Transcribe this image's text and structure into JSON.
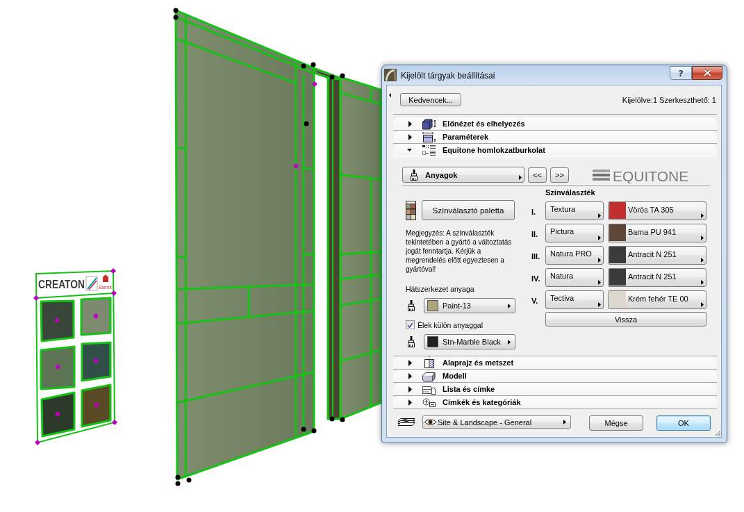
{
  "scene": {
    "board": {
      "logo": "CREATON",
      "brand": "Eternit",
      "tiles": [
        {
          "color": "#39473a"
        },
        {
          "color": "#7d8a70"
        },
        {
          "color": "#5d7455"
        },
        {
          "color": "#314e48"
        },
        {
          "color": "#2b3a29"
        },
        {
          "color": "#5b4a26"
        }
      ]
    }
  },
  "dialog": {
    "title": "Kijelölt tárgyak beállításai",
    "help_button": "?",
    "favorites_button": "Kedvencek...",
    "selection_info": "Kijelölve:1 Szerkeszthető: 1",
    "sections": [
      {
        "label": "Előnézet és elhelyezés",
        "kind": "preview",
        "expanded": false
      },
      {
        "label": "Paraméterek",
        "kind": "parameters",
        "expanded": false
      },
      {
        "label": "Equitone homlokzatburkolat",
        "kind": "custom",
        "expanded": true,
        "content": {
          "page": "Anyagok",
          "prev": "<<",
          "next": ">>",
          "logo": "EQUITONE",
          "palette_button": "Színválasztó paletta",
          "note": "Megjegyzés: A színválaszték tekintetében a gyártó a változtatás jogát fenntartja. Kérjük a megrendelés előtt egyeztesen a gyártóval!",
          "backing_label": "Hátszerkezet anyaga",
          "backing_material": {
            "name": "Paint-13",
            "color": "#aca57b"
          },
          "edges_option": {
            "label": "Élek külön anyaggal",
            "checked": true
          },
          "edge_material": {
            "name": "Stn-Marble Black",
            "color": "#1f1f1f"
          },
          "range_title": "Színválaszték",
          "ranges": [
            {
              "numeral": "I.",
              "product": "Textura",
              "color_name": "Vörös TA 305",
              "color": "#c42e2e"
            },
            {
              "numeral": "II.",
              "product": "Pictura",
              "color_name": "Barna PU 941",
              "color": "#5e4739"
            },
            {
              "numeral": "III.",
              "product": "Natura PRO",
              "color_name": "Antracit N 251",
              "color": "#3d3b39"
            },
            {
              "numeral": "IV.",
              "product": "Natura",
              "color_name": "Antracit N 251",
              "color": "#3d3b39"
            },
            {
              "numeral": "V.",
              "product": "Tectiva",
              "color_name": "Krém fehér TE 00",
              "color": "#ddd7cd"
            }
          ],
          "back_button": "Vissza"
        }
      },
      {
        "label": "Alaprajz és metszet",
        "kind": "floorplan",
        "expanded": false
      },
      {
        "label": "Modell",
        "kind": "model",
        "expanded": false
      },
      {
        "label": "Lista és címke",
        "kind": "listing",
        "expanded": false
      },
      {
        "label": "Címkék és kategóriák",
        "kind": "classification",
        "expanded": false
      }
    ],
    "layer": "Site & Landscape - General",
    "buttons": [
      {
        "label": "Mégse",
        "default": false
      },
      {
        "label": "OK",
        "default": true
      }
    ]
  }
}
